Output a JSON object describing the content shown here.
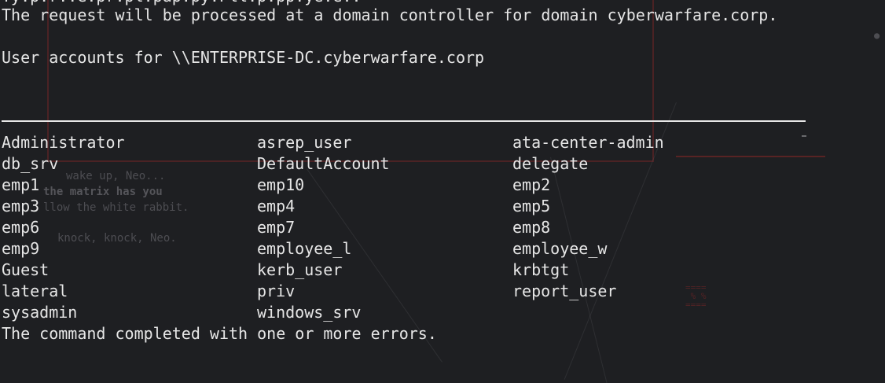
{
  "terminal": {
    "cut_off_top_line": "Ty.p.r..e.pr.pl.pap.py.Pll.p.pp.ye.e..",
    "request_line": "The request will be processed at a domain controller for domain cyberwarfare.corp.",
    "header_line": "User accounts for \\\\ENTERPRISE-DC.cyberwarfare.corp",
    "accounts": [
      [
        "Administrator",
        "asrep_user",
        "ata-center-admin"
      ],
      [
        "db_srv",
        "DefaultAccount",
        "delegate"
      ],
      [
        "emp1",
        "emp10",
        "emp2"
      ],
      [
        "emp3",
        "emp4",
        "emp5"
      ],
      [
        "emp6",
        "emp7",
        "emp8"
      ],
      [
        "emp9",
        "employee_l",
        "employee_w"
      ],
      [
        "Guest",
        "kerb_user",
        "krbtgt"
      ],
      [
        "lateral",
        "priv",
        "report_user"
      ],
      [
        "sysadmin",
        "windows_srv",
        ""
      ]
    ],
    "footer_line": "The command completed with one or more errors."
  },
  "background_art": {
    "wake_text": "wake up, Neo...",
    "matrix_text": "the matrix has you",
    "rabbit_text": "llow the white rabbit.",
    "knock_text": "knock, knock, Neo."
  },
  "colors": {
    "background": "#1e1f22",
    "text": "#e6e6e6",
    "faint_art": "#4d4d52",
    "red_art": "#a02828"
  }
}
